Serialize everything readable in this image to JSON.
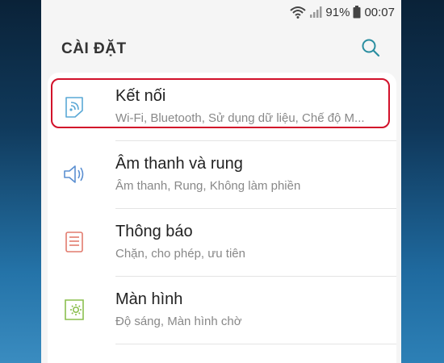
{
  "status_bar": {
    "battery_percent": "91%",
    "time": "00:07",
    "icons": [
      "wifi-icon",
      "signal-icon",
      "battery-icon"
    ]
  },
  "header": {
    "title": "CÀI ĐẶT",
    "search_icon": "search-icon"
  },
  "settings": [
    {
      "icon": "connections-icon",
      "color": "#5aa8d6",
      "title": "Kết nối",
      "subtitle": "Wi-Fi, Bluetooth, Sử dụng dữ liệu, Chế độ M..."
    },
    {
      "icon": "sound-icon",
      "color": "#5b8fd1",
      "title": "Âm thanh và rung",
      "subtitle": "Âm thanh, Rung, Không làm phiền"
    },
    {
      "icon": "notifications-icon",
      "color": "#e27b6e",
      "title": "Thông báo",
      "subtitle": "Chặn, cho phép, ưu tiên"
    },
    {
      "icon": "display-icon",
      "color": "#8bbf4f",
      "title": "Màn hình",
      "subtitle": "Độ sáng, Màn hình chờ"
    }
  ],
  "highlight_color": "#d2112a",
  "accent_color": "#2a8ea0"
}
